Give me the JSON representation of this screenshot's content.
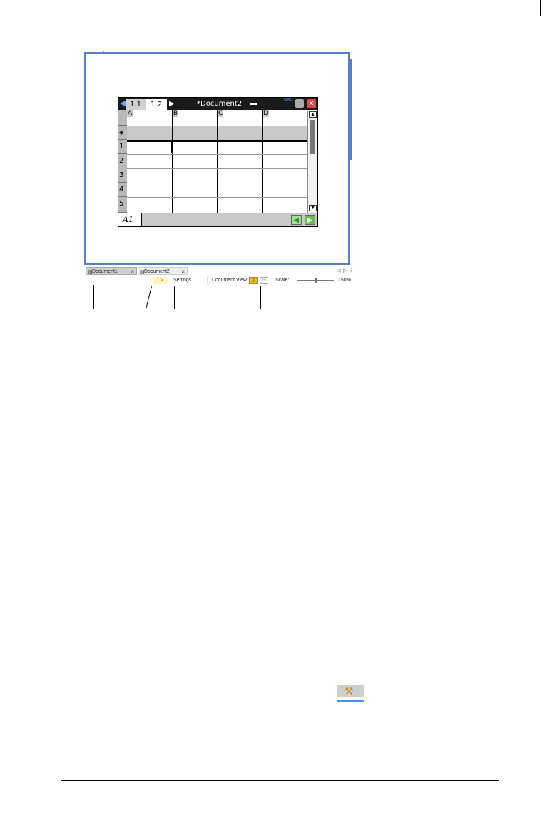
{
  "handheld": {
    "tabs": [
      "1.1",
      "1.2"
    ],
    "active_tab": "1.2",
    "doc_title": "*Document2",
    "cas_label": "CAS",
    "columns": [
      "A",
      "B",
      "C",
      "D"
    ],
    "rows": [
      "1",
      "2",
      "3",
      "4",
      "5"
    ],
    "formula_marker": "◆",
    "cell_ref": "A1"
  },
  "doc_tabs": [
    {
      "label": "Document1"
    },
    {
      "label": "Document2"
    }
  ],
  "status_bar": {
    "page": "1.2",
    "settings": "Settings",
    "document_view": "Document View",
    "scale_label": "Scale:",
    "scale_value": "150%"
  },
  "icons": {
    "tools": "tools-icon"
  }
}
